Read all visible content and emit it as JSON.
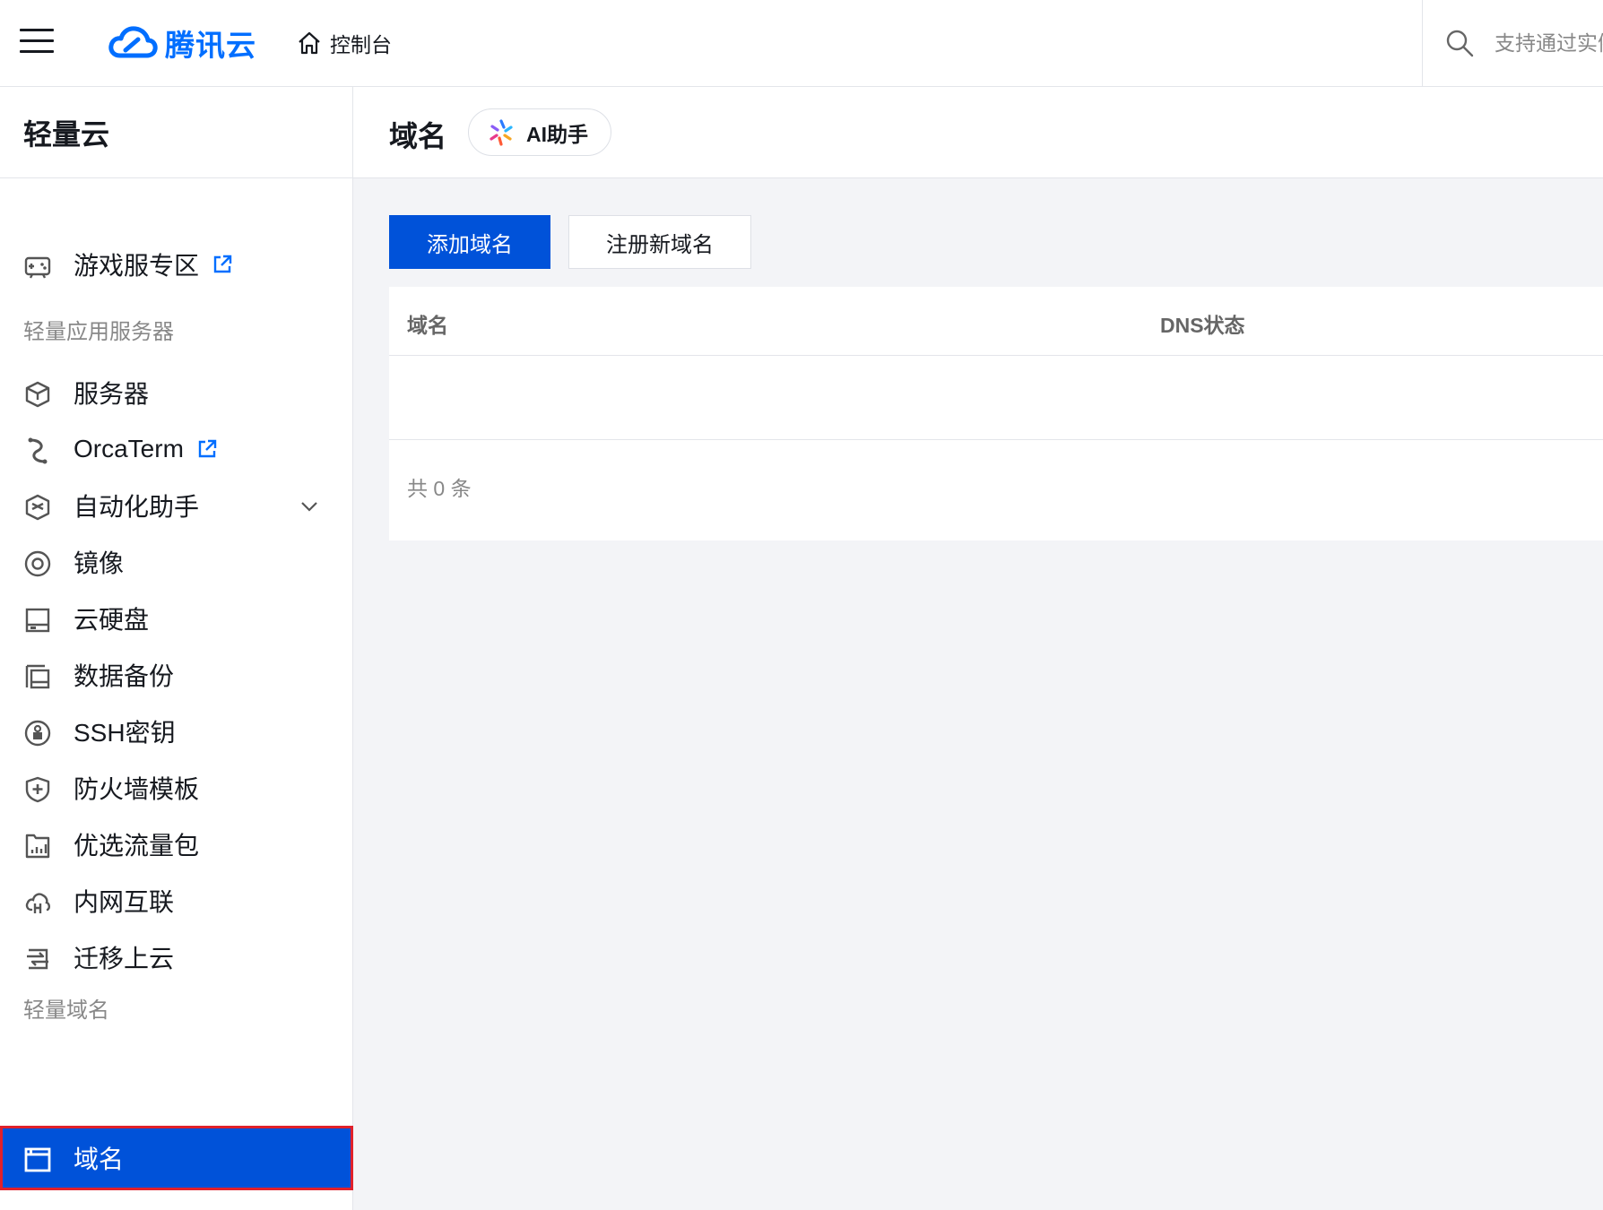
{
  "topbar": {
    "brand": "腾讯云",
    "console_label": "控制台",
    "search_placeholder": "支持通过实例ID、IP、名称搜索"
  },
  "sidebar": {
    "title": "轻量云",
    "items": [
      {
        "label": "游戏服专区",
        "icon": "gamepad-icon",
        "external": true
      },
      {
        "group": "轻量应用服务器"
      },
      {
        "label": "服务器",
        "icon": "server-cube-icon"
      },
      {
        "label": "OrcaTerm",
        "icon": "orcaterm-icon",
        "external": true
      },
      {
        "label": "自动化助手",
        "icon": "automation-icon",
        "expandable": true
      },
      {
        "label": "镜像",
        "icon": "image-disc-icon"
      },
      {
        "label": "云硬盘",
        "icon": "cloud-disk-icon"
      },
      {
        "label": "数据备份",
        "icon": "backup-icon"
      },
      {
        "label": "SSH密钥",
        "icon": "ssh-key-icon"
      },
      {
        "label": "防火墙模板",
        "icon": "firewall-shield-icon"
      },
      {
        "label": "优选流量包",
        "icon": "traffic-package-icon"
      },
      {
        "label": "内网互联",
        "icon": "intranet-icon"
      },
      {
        "label": "迁移上云",
        "icon": "migrate-icon"
      },
      {
        "group": "轻量域名"
      },
      {
        "label": "域名",
        "icon": "domain-window-icon",
        "active": true
      }
    ]
  },
  "page": {
    "title": "域名",
    "ai_label": "AI助手",
    "add_button": "添加域名",
    "register_button": "注册新域名",
    "table": {
      "columns": [
        "域名",
        "DNS状态"
      ],
      "rows": [],
      "total": "共 0 条"
    }
  },
  "colors": {
    "primary": "#0052d9",
    "brand": "#006eff",
    "active_outline": "#e0212b",
    "background": "#f3f4f7"
  }
}
